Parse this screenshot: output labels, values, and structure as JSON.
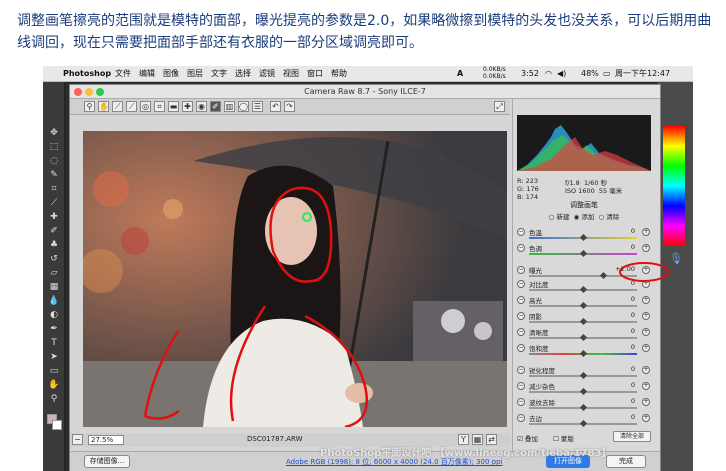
{
  "caption": "调整画笔擦亮的范围就是模特的面部，曝光提亮的参数是2.0，如果略微擦到模特的头发也没关系，可以后期用曲线调回，现在只需要把面部手部还有衣服的一部分区域调亮即可。",
  "menubar": {
    "app": "Photoshop",
    "items": [
      "文件",
      "编辑",
      "图像",
      "图层",
      "文字",
      "选择",
      "滤镜",
      "视图",
      "窗口",
      "帮助"
    ],
    "net_up": "0.0KB/s",
    "net_down": "0.0KB/s",
    "time_short": "3:52",
    "battery": "48%",
    "datetime": "周一下午12:47"
  },
  "dialog": {
    "title": "Camera Raw 8.7 - Sony ILCE-7",
    "zoom": "27.5%",
    "filename": "DSC01787.ARW"
  },
  "panel": {
    "rgb": {
      "r_label": "R:",
      "r": "223",
      "g_label": "G:",
      "g": "176",
      "b_label": "B:",
      "b": "174"
    },
    "aperture": "f/1.8",
    "shutter": "1/60 秒",
    "iso": "ISO 1600",
    "focal": "55 毫米",
    "section_title": "调整画笔",
    "modes": {
      "new": "新建",
      "add": "添加",
      "clear": "清除"
    },
    "sliders": [
      {
        "label": "色温",
        "value": "0"
      },
      {
        "label": "色调",
        "value": "0"
      },
      {
        "label": "曝光",
        "value": "+2.00"
      },
      {
        "label": "对比度",
        "value": "0"
      },
      {
        "label": "高光",
        "value": "0"
      },
      {
        "label": "阴影",
        "value": "0"
      },
      {
        "label": "清晰度",
        "value": "0"
      },
      {
        "label": "饱和度",
        "value": "0"
      },
      {
        "label": "锐化程度",
        "value": "0"
      },
      {
        "label": "减少杂色",
        "value": "0"
      },
      {
        "label": "波纹去除",
        "value": "0"
      },
      {
        "label": "去边",
        "value": "0"
      }
    ],
    "overlay_label": "叠加",
    "mask_label": "蒙版",
    "clear_all": "清除全部"
  },
  "footer": {
    "save_button": "存储图像...",
    "workflow_link": "Adobe RGB (1998); 8 位; 6000 x 4000 (24.0 百万像素); 300 ppi",
    "open_button": "打开图像",
    "done_button": "完成"
  },
  "watermark": "PhotoShop平面设计吧 【www.lineeg.com/tieba/1783】",
  "colors": {
    "accent": "#2e7ae6",
    "caption": "#1a3d7c",
    "annotation": "#e01010"
  }
}
